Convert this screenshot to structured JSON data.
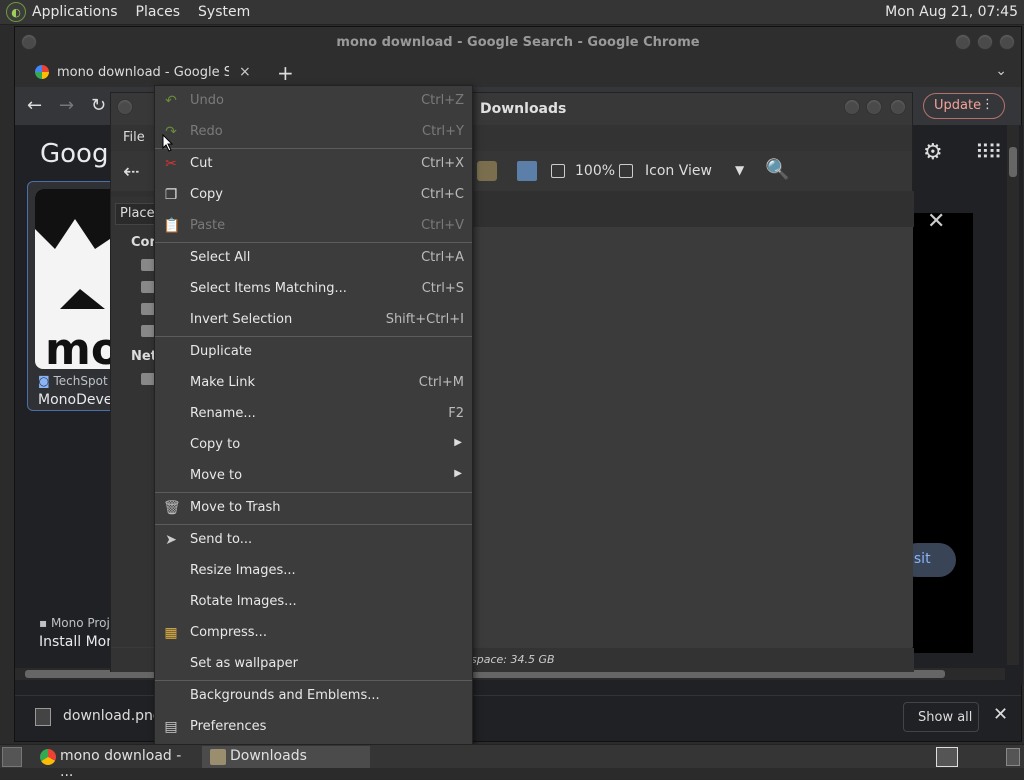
{
  "top_panel": {
    "menus": [
      "Applications",
      "Places",
      "System"
    ],
    "clock": "Mon Aug 21, 07:45"
  },
  "chrome": {
    "window_title": "mono download - Google Search - Google Chrome",
    "tab_title": "mono download - Google Sear",
    "tab_close": "×",
    "new_tab": "+",
    "tab_menu": "⌄",
    "update_label": "Update",
    "google_logo": "Googl",
    "result1": {
      "source": "TechSpot",
      "title": "MonoDevel"
    },
    "result2": {
      "source": "Mono Proj",
      "title": "Install Mono"
    },
    "visit_label": "isit",
    "download": {
      "filename": "download.png",
      "show_all": "Show all"
    }
  },
  "nautilus": {
    "title": "Downloads",
    "menu_file": "File",
    "zoom": "100%",
    "view_mode": "Icon View",
    "places_label": "Places",
    "sidebar_headers": [
      "Com",
      "Netw"
    ],
    "free_space": "space: 34.5 GB"
  },
  "context_menu": {
    "items": [
      {
        "label": "Undo",
        "accel": "Ctrl+Z",
        "disabled": true
      },
      {
        "label": "Redo",
        "accel": "Ctrl+Y",
        "disabled": true
      },
      {
        "label": "Cut",
        "accel": "Ctrl+X"
      },
      {
        "label": "Copy",
        "accel": "Ctrl+C"
      },
      {
        "label": "Paste",
        "accel": "Ctrl+V",
        "disabled": true
      },
      {
        "label": "Select All",
        "accel": "Ctrl+A"
      },
      {
        "label": "Select Items Matching...",
        "accel": "Ctrl+S"
      },
      {
        "label": "Invert Selection",
        "accel": "Shift+Ctrl+I"
      },
      {
        "label": "Duplicate",
        "accel": ""
      },
      {
        "label": "Make Link",
        "accel": "Ctrl+M"
      },
      {
        "label": "Rename...",
        "accel": "F2"
      },
      {
        "label": "Copy to",
        "accel": ""
      },
      {
        "label": "Move to",
        "accel": ""
      },
      {
        "label": "Move to Trash",
        "accel": ""
      },
      {
        "label": "Send to...",
        "accel": ""
      },
      {
        "label": "Resize Images...",
        "accel": ""
      },
      {
        "label": "Rotate Images...",
        "accel": ""
      },
      {
        "label": "Compress...",
        "accel": ""
      },
      {
        "label": "Set as wallpaper",
        "accel": ""
      },
      {
        "label": "Backgrounds and Emblems...",
        "accel": ""
      },
      {
        "label": "Preferences",
        "accel": ""
      }
    ]
  },
  "taskbar": {
    "items": [
      "mono download - ...",
      "Downloads"
    ]
  }
}
